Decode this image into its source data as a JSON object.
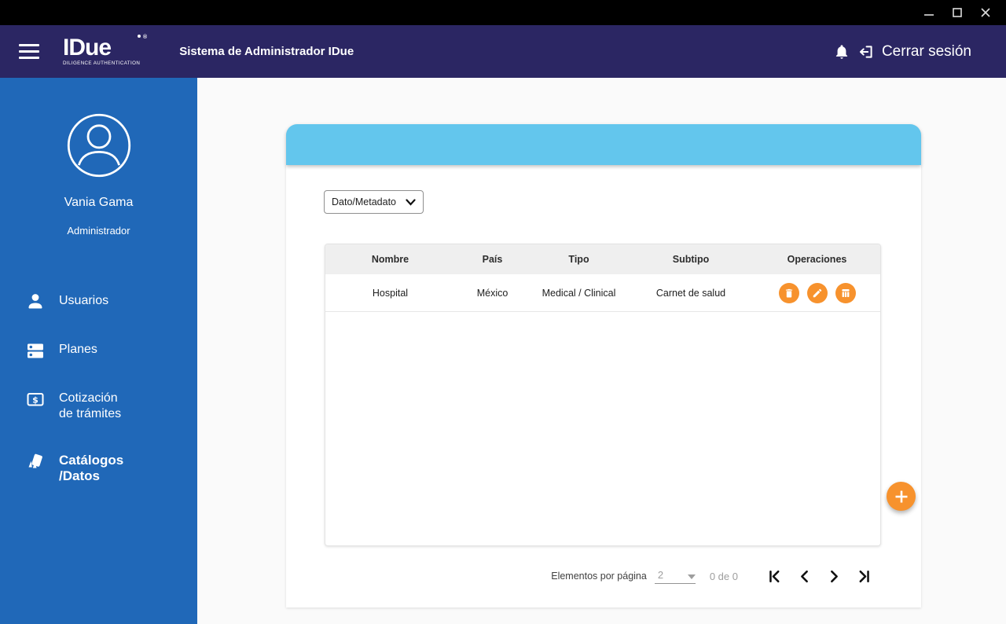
{
  "colors": {
    "appbar_navy": "#2b2663",
    "sidebar_blue": "#2068b8",
    "card_header_blue": "#63c6ed",
    "accent_orange": "#f7922d",
    "table_header_gray": "#efefef"
  },
  "window": {
    "minimize_icon": "minimize",
    "maximize_icon": "maximize",
    "close_icon": "close"
  },
  "appbar": {
    "logo_text": "IDue",
    "logo_sub": "DILIGENCE AUTHENTICATION",
    "title": "Sistema de Administrador IDue",
    "logout_label": "Cerrar sesión"
  },
  "sidebar": {
    "user": {
      "name": "Vania Gama",
      "role": "Administrador"
    },
    "items": [
      {
        "label": "Usuarios",
        "icon": "person-icon"
      },
      {
        "label": "Planes",
        "icon": "plans-icon"
      },
      {
        "label": "Cotización",
        "label2": "de trámites",
        "icon": "quote-currency-icon"
      },
      {
        "label": "Catálogos",
        "label2": "/Datos",
        "icon": "catalogs-icon",
        "active": true
      }
    ]
  },
  "content": {
    "filter": {
      "value": "Dato/Metadato"
    },
    "table": {
      "columns": [
        "Nombre",
        "País",
        "Tipo",
        "Subtipo",
        "Operaciones"
      ],
      "rows": [
        {
          "nombre": "Hospital",
          "pais": "México",
          "tipo": "Medical / Clinical",
          "subtipo": "Carnet de salud",
          "actions": [
            "delete",
            "edit",
            "table"
          ]
        }
      ]
    },
    "pagination": {
      "label": "Elementos por página",
      "page_size": "2",
      "range": "0 de 0"
    },
    "fab_label": "+"
  }
}
